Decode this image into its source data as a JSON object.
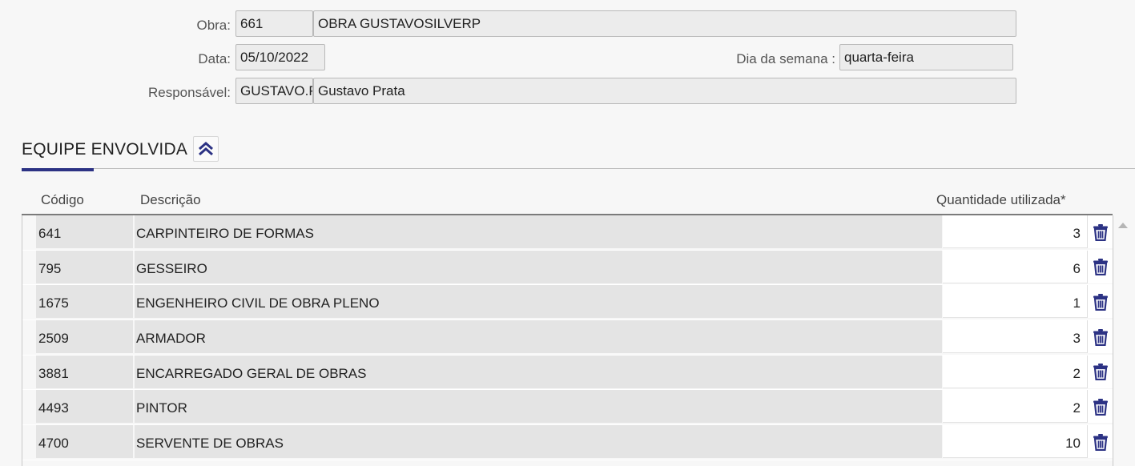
{
  "form": {
    "obra_label": "Obra:",
    "obra_code": "661",
    "obra_name": "OBRA GUSTAVOSILVERP",
    "data_label": "Data:",
    "data_value": "05/10/2022",
    "dia_label": "Dia da semana :",
    "dia_value": "quarta-feira",
    "resp_label": "Responsável:",
    "resp_code": "GUSTAVO.P",
    "resp_name": "Gustavo Prata"
  },
  "section": {
    "title": "EQUIPE ENVOLVIDA",
    "collapse_icon": "double-chevron-up-icon",
    "accent_color": "#2c3284"
  },
  "table": {
    "headers": {
      "codigo": "Código",
      "descricao": "Descrição",
      "quantidade": "Quantidade utilizada*"
    },
    "rows": [
      {
        "codigo": "641",
        "descricao": "CARPINTEIRO DE FORMAS",
        "quantidade": "3"
      },
      {
        "codigo": "795",
        "descricao": "GESSEIRO",
        "quantidade": "6"
      },
      {
        "codigo": "1675",
        "descricao": "ENGENHEIRO CIVIL DE OBRA PLENO",
        "quantidade": "1"
      },
      {
        "codigo": "2509",
        "descricao": "ARMADOR",
        "quantidade": "3"
      },
      {
        "codigo": "3881",
        "descricao": "ENCARREGADO GERAL DE OBRAS",
        "quantidade": "2"
      },
      {
        "codigo": "4493",
        "descricao": "PINTOR",
        "quantidade": "2"
      },
      {
        "codigo": "4700",
        "descricao": "SERVENTE DE OBRAS",
        "quantidade": "10"
      }
    ],
    "delete_icon": "trash-icon",
    "icon_color": "#2c3284"
  }
}
